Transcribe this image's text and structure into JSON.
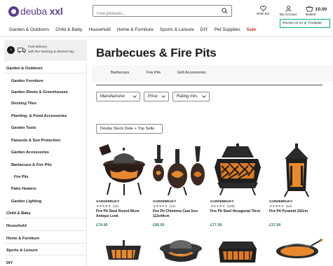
{
  "header": {
    "logo_brand": "deuba",
    "logo_suffix": "xxl",
    "search_placeholder": "Find products...",
    "wishlist_label": "Wish list",
    "account_label": "My Account",
    "basket_label": "Basket",
    "basket_total": "£0.00",
    "trustpilot_label": "Review us on",
    "trustpilot_brand": "Trustpilot"
  },
  "nav": [
    "Garden & Outdoors",
    "Child & Baby",
    "Household",
    "Home & Furniture",
    "Sports & Leisure",
    "DIY",
    "Pet Supplies",
    "Sale"
  ],
  "promo": {
    "line1": "Fast delivery",
    "line2": "with live tracking & desired day"
  },
  "sidebar": {
    "items": [
      {
        "label": "Garden & Outdoors",
        "level": 0
      },
      {
        "label": "Garden Furniture",
        "level": 1
      },
      {
        "label": "Garden Sheds & Greenhouses",
        "level": 1
      },
      {
        "label": "Decking Tiles",
        "level": 1
      },
      {
        "label": "Planting- & Pond Accessories",
        "level": 1
      },
      {
        "label": "Garden Tools",
        "level": 1
      },
      {
        "label": "Parasols & Sun Protection",
        "level": 1
      },
      {
        "label": "Garden Accessories",
        "level": 1
      },
      {
        "label": "Barbecues & Fire Pits",
        "level": 1
      },
      {
        "label": "Fire Pits",
        "level": 2
      },
      {
        "label": "Patio Heaters",
        "level": 1
      },
      {
        "label": "Garden Lighting",
        "level": 1
      },
      {
        "label": "Child & Baby",
        "level": 0
      },
      {
        "label": "Household",
        "level": 0
      },
      {
        "label": "Home & Furniture",
        "level": 0
      },
      {
        "label": "Sports & Leisure",
        "level": 0
      },
      {
        "label": "DIY",
        "level": 0
      }
    ]
  },
  "main": {
    "title": "Barbecues & Fire Pits",
    "subcategories": [
      "Barbecues",
      "Fire Pits",
      "Grill Accessories"
    ],
    "filters": [
      "Manufacturer",
      "Price",
      "Rating min."
    ],
    "sort_label": "Deuba Stock Date + Top Selle"
  },
  "products": [
    {
      "brand": "GARDEBRUK®",
      "rating": 4,
      "reviews": "(14)",
      "name": "Fire Pit Steel Round 66cm Antique Look",
      "price": "£79.95"
    },
    {
      "brand": "GARDEBRUK®",
      "rating": 4,
      "reviews": "(14)",
      "name": "Fire Pit Chiminea Cast Iron 112x44cm",
      "price": "£85.95"
    },
    {
      "brand": "GARDEBRUK®",
      "rating": 4,
      "reviews": "(126)",
      "name": "Fire Pit Steel Hexagonal 70cm",
      "price": "£77.95"
    },
    {
      "brand": "GARDEBRUK®",
      "rating": 4,
      "reviews": "(14)",
      "name": "Fire Pit Pyramid 102cm",
      "price": "£37.95"
    }
  ],
  "colors": {
    "brand_purple": "#5b3a8c",
    "price_green": "#2e7d4f",
    "sale_red": "#c0392b",
    "trustpilot_green": "#00b67a"
  }
}
